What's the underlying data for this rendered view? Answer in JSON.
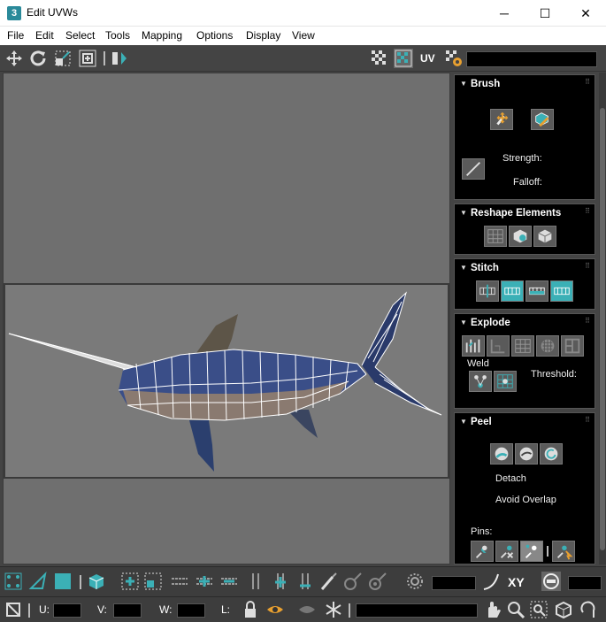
{
  "window": {
    "app_icon_label": "3",
    "title": "Edit UVWs",
    "minimize": "─",
    "maximize": "☐",
    "close": "✕"
  },
  "menu": [
    "File",
    "Edit",
    "Select",
    "Tools",
    "Mapping",
    "Options",
    "Display",
    "View"
  ],
  "toolbar": {
    "uv_label": "UV",
    "uv_dropdown_value": ""
  },
  "brush": {
    "title": "Brush",
    "strength_label": "Strength:",
    "falloff_label": "Falloff:"
  },
  "reshape": {
    "title": "Reshape Elements"
  },
  "stitch": {
    "title": "Stitch"
  },
  "explode": {
    "title": "Explode",
    "weld_label": "Weld",
    "threshold_label": "Threshold:"
  },
  "peel": {
    "title": "Peel",
    "detach_label": "Detach",
    "avoid_overlap_label": "Avoid Overlap",
    "pins_label": "Pins:"
  },
  "bottom": {
    "xy_label": "XY",
    "u_label": "U:",
    "v_label": "V:",
    "w_label": "W:",
    "l_label": "L:"
  },
  "colors": {
    "accent": "#3bb0b6",
    "panel": "#000000",
    "viewport": "#6f6f6f"
  }
}
